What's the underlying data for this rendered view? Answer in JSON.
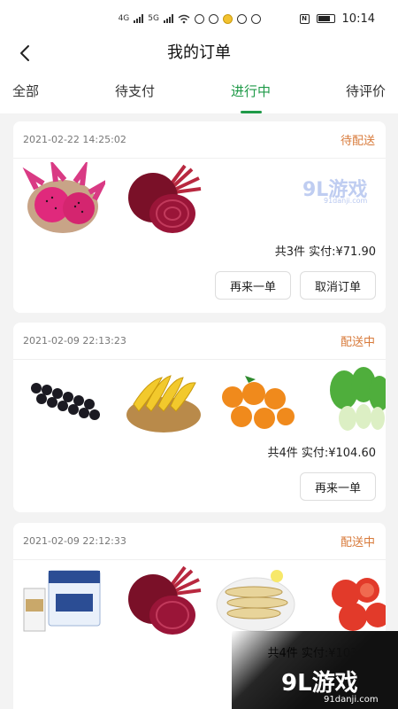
{
  "status_bar": {
    "network_left": "4G",
    "network_right": "5G",
    "time": "10:14"
  },
  "header": {
    "title": "我的订单",
    "back_icon": "chevron-left-icon"
  },
  "tabs": [
    {
      "label": "全部",
      "active": false
    },
    {
      "label": "待支付",
      "active": false
    },
    {
      "label": "进行中",
      "active": true
    },
    {
      "label": "待评价",
      "active": false
    }
  ],
  "accent_color": "#1f9a48",
  "status_color": "#d87a3a",
  "orders": [
    {
      "time": "2021-02-22 14:25:02",
      "status": "待配送",
      "products": [
        "dragon-fruit",
        "beetroot"
      ],
      "summary": "共3件 实付:¥71.90",
      "buttons": [
        "再来一单",
        "取消订单"
      ]
    },
    {
      "time": "2021-02-09 22:13:23",
      "status": "配送中",
      "products": [
        "grapes",
        "bananas",
        "oranges",
        "bok-choy"
      ],
      "summary": "共4件 实付:¥104.60",
      "buttons": [
        "再来一单"
      ]
    },
    {
      "time": "2021-02-09 22:12:33",
      "status": "配送中",
      "products": [
        "milk",
        "beetroot",
        "fish",
        "tomatoes"
      ],
      "summary": "共4件 实付:¥103.79",
      "buttons": []
    }
  ],
  "watermark": {
    "logo_top": "9L游戏",
    "logo_top_sub": "91danji.com",
    "logo_bottom": "9L游戏",
    "logo_bottom_sub": "91danji.com"
  }
}
